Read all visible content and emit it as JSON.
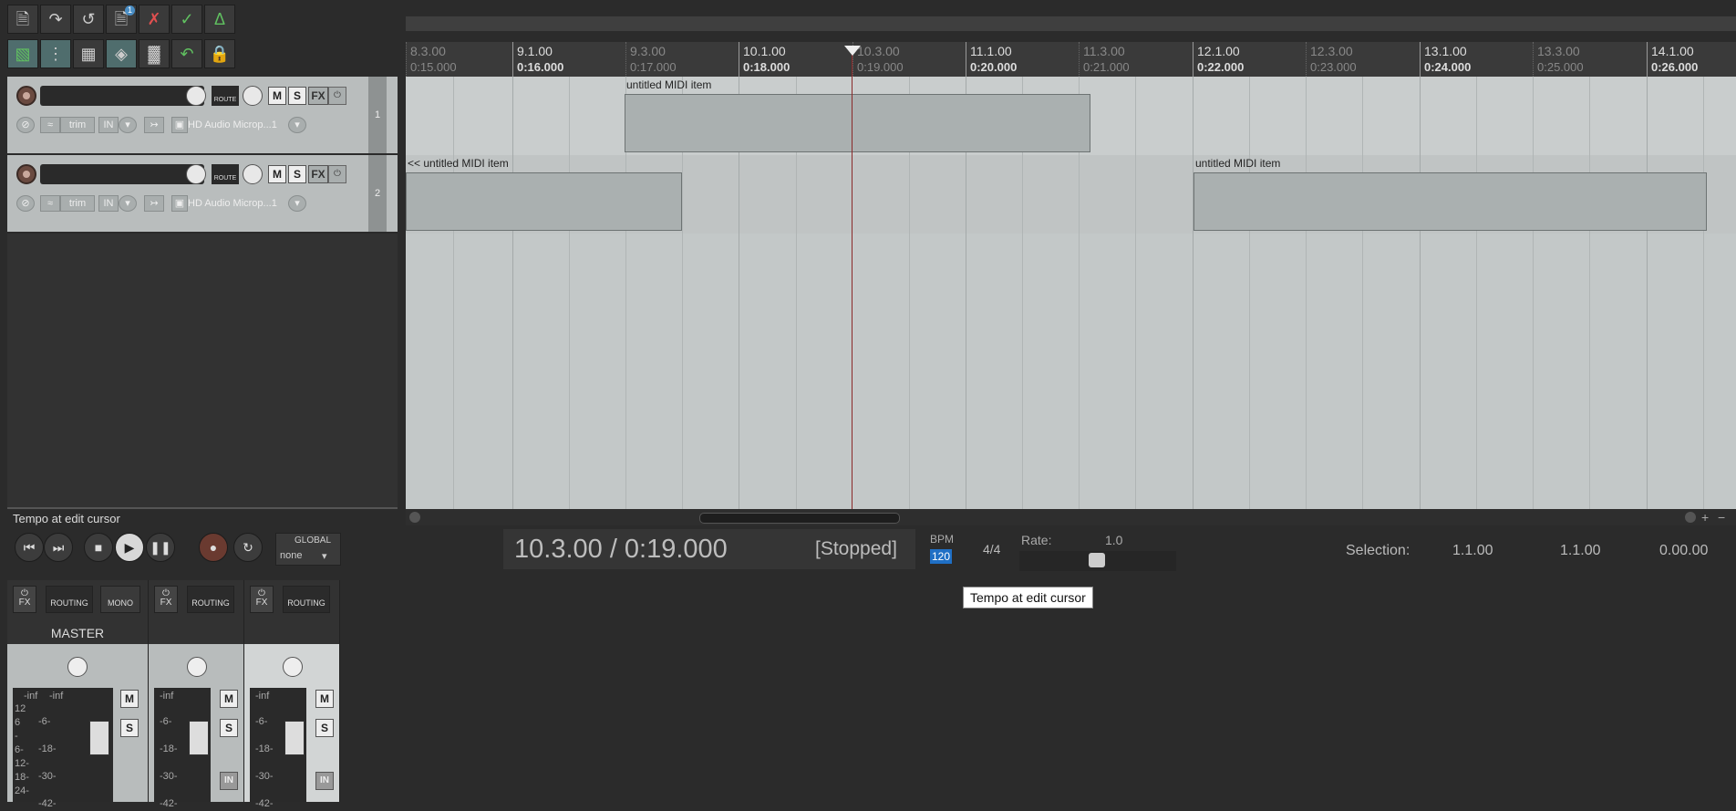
{
  "toolbar": {
    "new_project_icon": "new-project-icon",
    "open_badge": "1"
  },
  "tracks": [
    {
      "num": "1",
      "input": "HD Audio Microp...1",
      "trim": "trim",
      "in": "IN",
      "route": "ROUTE",
      "m": "M",
      "s": "S",
      "fx": "FX"
    },
    {
      "num": "2",
      "input": "HD Audio Microp...1",
      "trim": "trim",
      "in": "IN",
      "route": "ROUTE",
      "m": "M",
      "s": "S",
      "fx": "FX"
    }
  ],
  "ruler": {
    "ticks": [
      {
        "bar": "8.3.00",
        "time": "0:15.000",
        "minor": true
      },
      {
        "bar": "9.1.00",
        "time": "0:16.000",
        "minor": false
      },
      {
        "bar": "9.3.00",
        "time": "0:17.000",
        "minor": true
      },
      {
        "bar": "10.1.00",
        "time": "0:18.000",
        "minor": false
      },
      {
        "bar": "10.3.00",
        "time": "0:19.000",
        "minor": true
      },
      {
        "bar": "11.1.00",
        "time": "0:20.000",
        "minor": false
      },
      {
        "bar": "11.3.00",
        "time": "0:21.000",
        "minor": true
      },
      {
        "bar": "12.1.00",
        "time": "0:22.000",
        "minor": false
      },
      {
        "bar": "12.3.00",
        "time": "0:23.000",
        "minor": true
      },
      {
        "bar": "13.1.00",
        "time": "0:24.000",
        "minor": false
      },
      {
        "bar": "13.3.00",
        "time": "0:25.000",
        "minor": true
      },
      {
        "bar": "14.1.00",
        "time": "0:26.000",
        "minor": false
      }
    ]
  },
  "items": {
    "track1_item": "untitled MIDI item",
    "track2_item_a": "<< untitled MIDI item",
    "track2_item_b": "untitled MIDI item"
  },
  "status": {
    "hover_label": "Tempo at edit cursor"
  },
  "transport": {
    "position": "10.3.00 / 0:19.000",
    "state": "[Stopped]",
    "bpm_label": "BPM",
    "bpm": "120",
    "time_signature": "4/4",
    "rate_label": "Rate:",
    "rate": "1.0",
    "global_label": "GLOBAL",
    "global_value": "none",
    "selection_label": "Selection:",
    "selection_start": "1.1.00",
    "selection_end": "1.1.00",
    "selection_length": "0.00.00",
    "tooltip": "Tempo at edit cursor"
  },
  "mixer": {
    "master_label": "MASTER",
    "fx": "FX",
    "routing": "ROUTING",
    "mono": "MONO",
    "m": "M",
    "s": "S",
    "inf": "-inf",
    "in": "IN"
  }
}
